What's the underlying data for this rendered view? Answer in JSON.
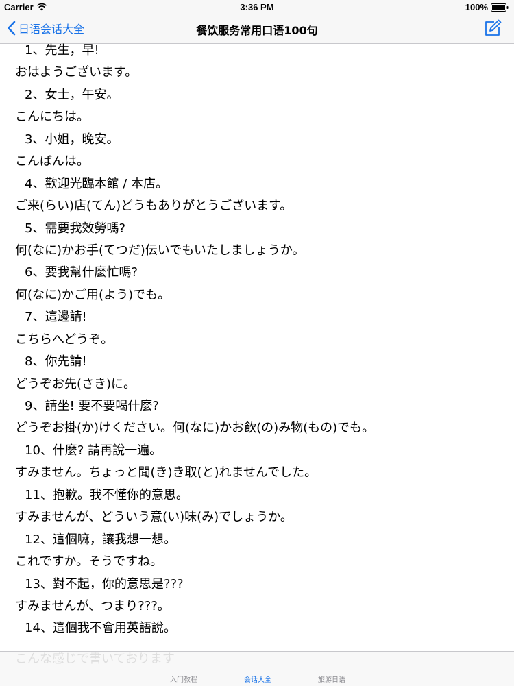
{
  "status_bar": {
    "carrier": "Carrier",
    "time": "3:36 PM",
    "battery": "100%"
  },
  "nav": {
    "back_label": "日语会话大全",
    "title": "餐饮服务常用口语100句"
  },
  "colors": {
    "accent": "#1a73e8",
    "bar_background": "#f7f7f7",
    "separator": "#c8c8cc"
  },
  "icons": {
    "back": "chevron-left-icon",
    "compose": "compose-icon",
    "wifi": "wifi-icon",
    "battery": "battery-icon"
  },
  "phrases": [
    {
      "zh": "1、先生，早!",
      "ja": "おはようございます。"
    },
    {
      "zh": "2、女士，午安。",
      "ja": "こんにちは。"
    },
    {
      "zh": "3、小姐，晚安。",
      "ja": "こんばんは。"
    },
    {
      "zh": "4、歡迎光臨本館 / 本店。",
      "ja": "ご来(らい)店(てん)どうもありがとうございます。"
    },
    {
      "zh": "5、需要我效勞嗎?",
      "ja": "何(なに)かお手(てつだ)伝いでもいたしましょうか。"
    },
    {
      "zh": "6、要我幫什麼忙嗎?",
      "ja": "何(なに)かご用(よう)でも。"
    },
    {
      "zh": "7、這邊請!",
      "ja": "こちらへどうぞ。"
    },
    {
      "zh": "8、你先請!",
      "ja": "どうぞお先(さき)に。"
    },
    {
      "zh": "9、請坐! 要不要喝什麼?",
      "ja": "どうぞお掛(か)けください。何(なに)かお飲(の)み物(もの)でも。"
    },
    {
      "zh": "10、什麼? 請再說一遍。",
      "ja": "すみません。ちょっと聞(き)き取(と)れませんでした。"
    },
    {
      "zh": "11、抱歉。我不懂你的意思。",
      "ja": "すみませんが、どういう意(い)味(み)でしょうか。"
    },
    {
      "zh": "12、這個嘛，讓我想一想。",
      "ja": "これですか。そうですね。"
    },
    {
      "zh": "13、對不起，你的意思是???",
      "ja": "すみませんが、つまり???。"
    },
    {
      "zh": "14、這個我不會用英語說。",
      "ja": ""
    }
  ],
  "tabs": [
    {
      "label": "入门教程",
      "active": false
    },
    {
      "label": "会话大全",
      "active": true
    },
    {
      "label": "旅游日语",
      "active": false
    }
  ]
}
